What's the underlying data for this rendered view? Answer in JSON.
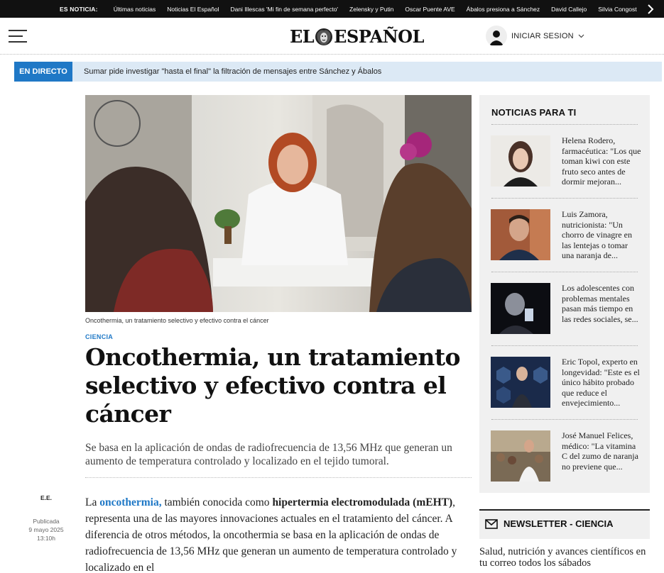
{
  "topbar": {
    "lead": "ES NOTICIA:",
    "links": [
      "Últimas noticias",
      "Noticias El Español",
      "Dani Illescas 'Mi fin de semana perfecto'",
      "Zelensky y Putin",
      "Oscar Puente AVE",
      "Ábalos presiona a Sánchez",
      "David Callejo",
      "Silvia Congost"
    ]
  },
  "header": {
    "logo_left": "EL",
    "logo_right": "ESPAÑOL",
    "login": "INICIAR SESION"
  },
  "live": {
    "tag": "EN DIRECTO",
    "headline": "Sumar pide investigar \"hasta el final\" la filtración de mensajes entre Sánchez y Ábalos"
  },
  "article": {
    "caption": "Oncothermia, un tratamiento selectivo y efectivo contra el cáncer",
    "category": "CIENCIA",
    "title": "Oncothermia, un tratamiento selectivo y efectivo contra el cáncer",
    "subtitle": "Se basa en la aplicación de ondas de radiofrecuencia de 13,56 MHz que generan un aumento de temperatura controlado y localizado en el tejido tumoral.",
    "author": "E.E.",
    "published_label": "Publicada",
    "published_date": "9 mayo 2025",
    "published_time": "13:10h",
    "body_p1": "La",
    "body_link": "oncothermia,",
    "body_p2": " también conocida como ",
    "body_bold": "hipertermia electromodulada (mEHT)",
    "body_p3": ", representa una de las mayores innovaciones actuales en el tratamiento del cáncer. A diferencia de otros métodos, la oncothermia se basa en la aplicación de ondas de radiofrecuencia de 13,56 MHz que generan un aumento de temperatura controlado y localizado en el"
  },
  "sidebar": {
    "heading": "NOTICIAS PARA TI",
    "items": [
      {
        "text": "Helena Rodero, farmacéutica: \"Los que toman kiwi con este fruto seco antes de dormir mejoran..."
      },
      {
        "text": "Luis Zamora, nutricionista: \"Un chorro de vinagre en las lentejas o tomar una naranja de..."
      },
      {
        "text": "Los adolescentes con problemas mentales pasan más tiempo en las redes sociales, se..."
      },
      {
        "text": "Eric Topol, experto en longevidad: \"Este es el único hábito probado que reduce el envejecimiento..."
      },
      {
        "text": "José Manuel Felices, médico: \"La vitamina C del zumo de naranja no previene que..."
      }
    ]
  },
  "newsletter": {
    "title": "NEWSLETTER - CIENCIA",
    "desc": "Salud, nutrición y avances científicos en tu correo todos los sábados"
  },
  "colors": {
    "accent": "#1f78c6",
    "live_bg": "#dce9f5",
    "topbar_bg": "#111111",
    "sidebar_bg": "#f0f0f0"
  },
  "icons": [
    "hamburger-menu-icon",
    "lion-logo-icon",
    "user-avatar-icon",
    "chevron-down-icon",
    "chevron-right-icon",
    "mail-icon"
  ]
}
